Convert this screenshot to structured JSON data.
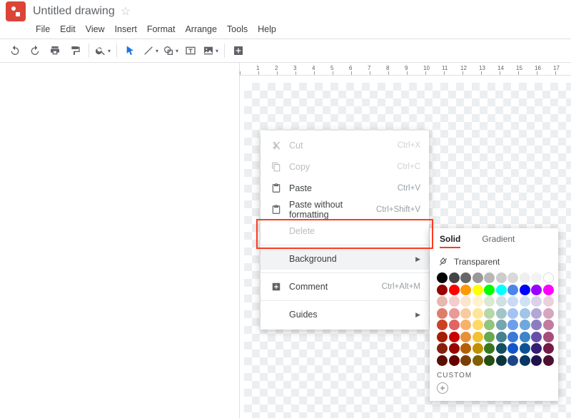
{
  "header": {
    "doc_title": "Untitled drawing"
  },
  "menubar": [
    "File",
    "Edit",
    "View",
    "Insert",
    "Format",
    "Arrange",
    "Tools",
    "Help"
  ],
  "ruler": [
    1,
    2,
    3,
    4,
    5,
    6,
    7,
    8,
    9,
    10,
    11,
    12,
    13,
    14,
    15,
    16,
    17
  ],
  "context_menu": {
    "cut": {
      "label": "Cut",
      "shortcut": "Ctrl+X"
    },
    "copy": {
      "label": "Copy",
      "shortcut": "Ctrl+C"
    },
    "paste": {
      "label": "Paste",
      "shortcut": "Ctrl+V"
    },
    "paste_plain": {
      "label": "Paste without formatting",
      "shortcut": "Ctrl+Shift+V"
    },
    "delete": {
      "label": "Delete"
    },
    "background": {
      "label": "Background"
    },
    "comment": {
      "label": "Comment",
      "shortcut": "Ctrl+Alt+M"
    },
    "guides": {
      "label": "Guides"
    }
  },
  "color_picker": {
    "tab_solid": "Solid",
    "tab_gradient": "Gradient",
    "transparent_label": "Transparent",
    "custom_label": "CUSTOM",
    "rows": [
      [
        "#000000",
        "#434343",
        "#666666",
        "#999999",
        "#b7b7b7",
        "#cccccc",
        "#d9d9d9",
        "#efefef",
        "#f3f3f3",
        "#ffffff"
      ],
      [
        "#980000",
        "#ff0000",
        "#ff9900",
        "#ffff00",
        "#00ff00",
        "#00ffff",
        "#4a86e8",
        "#0000ff",
        "#9900ff",
        "#ff00ff"
      ],
      [
        "#e6b8af",
        "#f4cccc",
        "#fce5cd",
        "#fff2cc",
        "#d9ead3",
        "#d0e0e3",
        "#c9daf8",
        "#cfe2f3",
        "#d9d2e9",
        "#ead1dc"
      ],
      [
        "#dd7e6b",
        "#ea9999",
        "#f9cb9c",
        "#ffe599",
        "#b6d7a8",
        "#a2c4c9",
        "#a4c2f4",
        "#9fc5e8",
        "#b4a7d6",
        "#d5a6bd"
      ],
      [
        "#cc4125",
        "#e06666",
        "#f6b26b",
        "#ffd966",
        "#93c47d",
        "#76a5af",
        "#6d9eeb",
        "#6fa8dc",
        "#8e7cc3",
        "#c27ba0"
      ],
      [
        "#a61c00",
        "#cc0000",
        "#e69138",
        "#f1c232",
        "#6aa84f",
        "#45818e",
        "#3c78d8",
        "#3d85c6",
        "#674ea7",
        "#a64d79"
      ],
      [
        "#85200c",
        "#990000",
        "#b45f06",
        "#bf9000",
        "#38761d",
        "#134f5c",
        "#1155cc",
        "#0b5394",
        "#351c75",
        "#741b47"
      ],
      [
        "#5b0f00",
        "#660000",
        "#783f04",
        "#7f6000",
        "#274e13",
        "#0c343d",
        "#1c4587",
        "#073763",
        "#20124d",
        "#4c1130"
      ]
    ]
  }
}
